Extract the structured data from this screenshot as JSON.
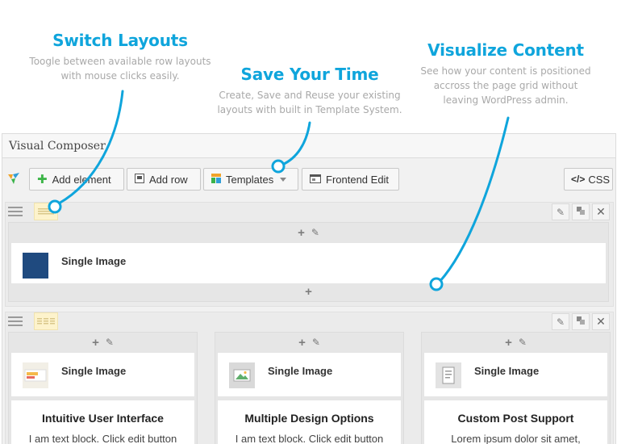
{
  "callouts": {
    "switch": {
      "title": "Switch Layouts",
      "line1": "Toogle between available row layouts",
      "line2": "with mouse clicks easily."
    },
    "save": {
      "title": "Save Your Time",
      "line1": "Create, Save and Reuse your existing",
      "line2": "layouts with built in Template System."
    },
    "visualize": {
      "title": "Visualize Content",
      "line1": "See how your content is positioned",
      "line2": "accross the page grid without",
      "line3": "leaving WordPress admin."
    }
  },
  "window": {
    "title": "Visual Composer"
  },
  "toolbar": {
    "add_element": "Add element",
    "add_row": "Add row",
    "templates": "Templates",
    "frontend_edit": "Frontend Edit",
    "css": "CSS",
    "css_icon_text": "</>"
  },
  "row1": {
    "element_title": "Single Image"
  },
  "row2": {
    "columns": [
      {
        "element_title": "Single Image",
        "text_title": "Intuitive User Interface",
        "text_body": "I am text block. Click edit button"
      },
      {
        "element_title": "Single Image",
        "text_title": "Multiple Design Options",
        "text_body": "I am text block. Click edit button"
      },
      {
        "element_title": "Single Image",
        "text_title": "Custom Post Support",
        "text_body": "Lorem ipsum dolor sit amet,"
      }
    ]
  },
  "colors": {
    "accent": "#0fa5dc",
    "muted_text": "#a9a9a9",
    "add_green": "#3eb549"
  }
}
